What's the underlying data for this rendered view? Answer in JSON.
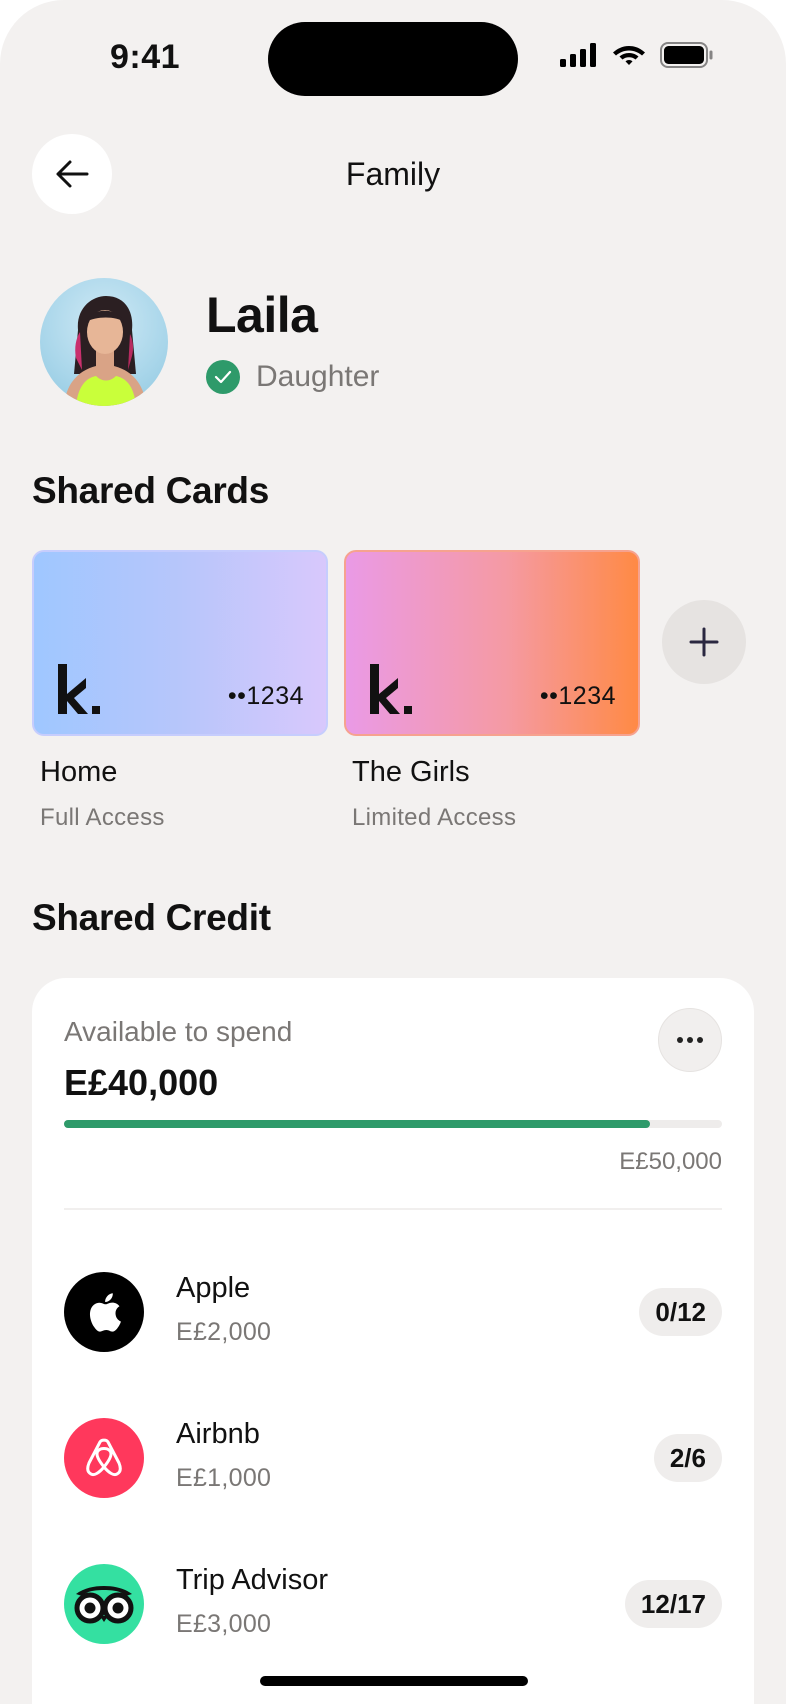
{
  "status_bar": {
    "time": "9:41"
  },
  "header": {
    "title": "Family"
  },
  "profile": {
    "name": "Laila",
    "role": "Daughter"
  },
  "shared_cards": {
    "title": "Shared Cards",
    "cards": [
      {
        "name": "Home",
        "access": "Full Access",
        "number": "••1234"
      },
      {
        "name": "The Girls",
        "access": "Limited Access",
        "number": "••1234"
      }
    ]
  },
  "shared_credit": {
    "title": "Shared Credit",
    "available_label": "Available to spend",
    "available_amount": "E£40,000",
    "limit": "E£50,000",
    "progress_fraction": 0.89,
    "progress_color": "#2e9a6a",
    "merchants": [
      {
        "name": "Apple",
        "amount": "E£2,000",
        "installments": "0/12",
        "icon": "apple-icon",
        "color": "#000000"
      },
      {
        "name": "Airbnb",
        "amount": "E£1,000",
        "installments": "2/6",
        "icon": "airbnb-icon",
        "color": "#ff385c"
      },
      {
        "name": "Trip Advisor",
        "amount": "E£3,000",
        "installments": "12/17",
        "icon": "tripadvisor-icon",
        "color": "#34e0a1"
      }
    ]
  }
}
